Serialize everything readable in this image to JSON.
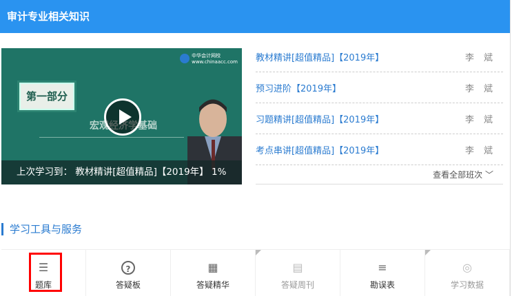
{
  "header": {
    "title": "审计专业相关知识"
  },
  "video": {
    "logo": "中华会计网校",
    "logo_url": "www.chinaacc.com",
    "badge": "第一部分",
    "subtitle": "宏观经济学基础",
    "last_study_label": "上次学习到：",
    "last_study_course": "教材精讲[超值精品]【2019年】",
    "progress": "1%"
  },
  "courses": [
    {
      "title": "教材精讲[超值精品]【2019年】",
      "teacher": "李斌"
    },
    {
      "title": "预习进阶【2019年】",
      "teacher": "李斌"
    },
    {
      "title": "习题精讲[超值精品]【2019年】",
      "teacher": "李斌"
    },
    {
      "title": "考点串讲[超值精品]【2019年】",
      "teacher": "李斌"
    }
  ],
  "more_label": "查看全部班次 ﹀",
  "section_title": "学习工具与服务",
  "tools": [
    {
      "label": "题库",
      "icon": "☰"
    },
    {
      "label": "答疑板",
      "icon": "?"
    },
    {
      "label": "答疑精华",
      "icon": "▦"
    },
    {
      "label": "答疑周刊",
      "icon": "▤"
    },
    {
      "label": "勘误表",
      "icon": "≡"
    },
    {
      "label": "学习数据",
      "icon": "◎"
    }
  ]
}
